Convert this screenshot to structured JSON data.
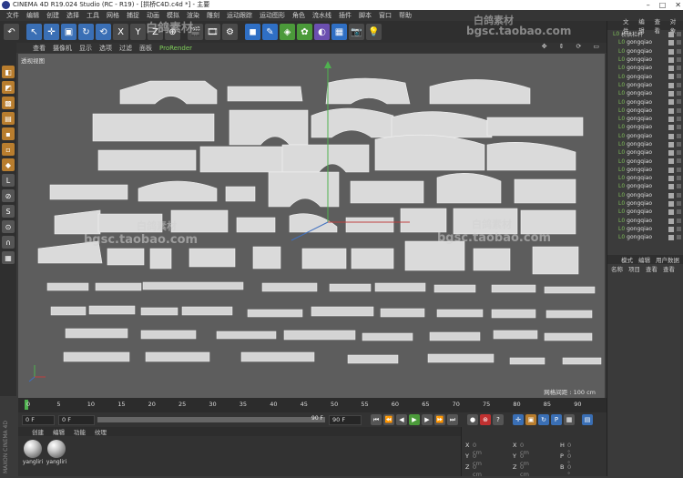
{
  "titlebar": {
    "title": "CINEMA 4D R19.024 Studio (RC - R19) - [拱桥C4D.c4d *] - 主要"
  },
  "watermark": {
    "name": "白鸽素材",
    "url": "bgsc.taobao.com"
  },
  "menu": [
    "文件",
    "编辑",
    "创建",
    "选择",
    "工具",
    "网格",
    "捕捉",
    "动画",
    "模拟",
    "渲染",
    "雕刻",
    "运动跟踪",
    "运动图形",
    "角色",
    "流水线",
    "插件",
    "脚本",
    "窗口",
    "帮助"
  ],
  "view": {
    "menu": [
      "查看",
      "摄像机",
      "显示",
      "选项",
      "过滤",
      "面板",
      "ProRender"
    ],
    "label": "透视视图",
    "grid_label": "网格间距 : 100 cm"
  },
  "timeline": {
    "ticks": [
      "0",
      "5",
      "10",
      "15",
      "20",
      "25",
      "30",
      "35",
      "40",
      "45",
      "50",
      "55",
      "60",
      "65",
      "70",
      "75",
      "80",
      "85",
      "90"
    ],
    "end": "0 F"
  },
  "playback": {
    "start": "0 F",
    "current": "0 F",
    "end_a": "90 F",
    "end_b": "90 F"
  },
  "materials": {
    "menu": [
      "创建",
      "编辑",
      "功能",
      "纹理"
    ],
    "items": [
      "yangliri",
      "yangliri"
    ]
  },
  "coords": {
    "rows": [
      {
        "a": "X",
        "av": "0 cm",
        "b": "X",
        "bv": "0 cm",
        "c": "H",
        "cv": "0 °"
      },
      {
        "a": "Y",
        "av": "0 cm",
        "b": "Y",
        "bv": "0 cm",
        "c": "P",
        "cv": "0 °"
      },
      {
        "a": "Z",
        "av": "0 cm",
        "b": "Z",
        "bv": "0 cm",
        "c": "B",
        "cv": "0 °"
      }
    ]
  },
  "objects": {
    "tabs": [
      "文件",
      "编辑",
      "查看",
      "对象"
    ],
    "items": [
      "桥拱栏杆",
      "gongqiao",
      "gongqiao",
      "gongqiao",
      "gongqiao",
      "gongqiao",
      "gongqiao",
      "gongqiao",
      "gongqiao",
      "gongqiao",
      "gongqiao",
      "gongqiao",
      "gongqiao",
      "gongqiao",
      "gongqiao",
      "gongqiao",
      "gongqiao",
      "gongqiao",
      "gongqiao",
      "gongqiao",
      "gongqiao",
      "gongqiao",
      "gongqiao",
      "gongqiao",
      "gongqiao"
    ]
  },
  "attributes": {
    "tabs": [
      "模式",
      "编辑",
      "用户数据"
    ],
    "row": [
      "名称",
      "项目",
      "查看",
      "查看"
    ]
  },
  "brand": "MAXON CINEMA 4D"
}
